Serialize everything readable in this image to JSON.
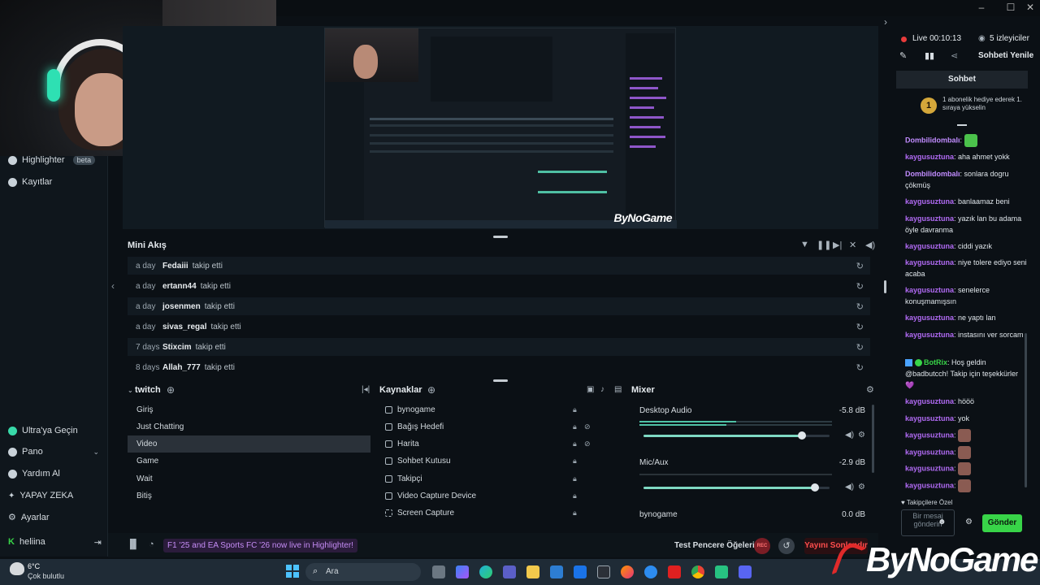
{
  "sidebar": {
    "highlighter": "Highlighter",
    "beta": "beta",
    "recordings": "Kayıtlar",
    "ultra": "Ultra'ya Geçin",
    "dashboard": "Pano",
    "help": "Yardım Al",
    "ai": "YAPAY ZEKA",
    "settings": "Ayarlar",
    "user": "heliina"
  },
  "mini_feed": {
    "title": "Mini Akış",
    "rows": [
      {
        "time": "a day",
        "user": "Fedaiii",
        "action": "takip etti"
      },
      {
        "time": "a day",
        "user": "ertann44",
        "action": "takip etti"
      },
      {
        "time": "a day",
        "user": "josenmen",
        "action": "takip etti"
      },
      {
        "time": "a day",
        "user": "sivas_regal",
        "action": "takip etti"
      },
      {
        "time": "7 days",
        "user": "Stixcim",
        "action": "takip etti"
      },
      {
        "time": "8 days",
        "user": "Allah_777",
        "action": "takip etti"
      }
    ]
  },
  "scenes": {
    "title": "twitch",
    "items": [
      "Giriş",
      "Just Chatting",
      "Video",
      "Game",
      "Wait",
      "Bitiş"
    ],
    "active_index": 2
  },
  "sources": {
    "title": "Kaynaklar",
    "items": [
      "bynogame",
      "Bağış Hedefi",
      "Harita",
      "Sohbet Kutusu",
      "Takipçi",
      "Video Capture Device",
      "Screen Capture"
    ]
  },
  "mixer": {
    "title": "Mixer",
    "channels": [
      {
        "name": "Desktop Audio",
        "db": "-5.8 dB",
        "level": 0.85
      },
      {
        "name": "Mic/Aux",
        "db": "-2.9 dB",
        "level": 0.92
      },
      {
        "name": "bynogame",
        "db": "0.0 dB",
        "level": 0
      }
    ]
  },
  "status": {
    "banner": "F1 '25 and EA Sports FC '26 now live in Highlighter!",
    "test_elements": "Test Pencere Öğeleri",
    "rec": "REC",
    "live_button": "Yayını Sonlandır"
  },
  "chat": {
    "live": "Live 00:10:13",
    "viewers": "5 izleyiciler",
    "refresh": "Sohbeti Yenile",
    "header": "Sohbet",
    "gift_badge": "1",
    "gift_text": "1 abonelik hediye ederek 1. sıraya yükselin",
    "messages": [
      {
        "user": "Dombilidombalı",
        "text": ""
      },
      {
        "user": "kaygusuztuna",
        "text": "aha ahmet yokk"
      },
      {
        "user": "Dombilidombalı",
        "text": "sonlara dogru çökmüş"
      },
      {
        "user": "kaygusuztuna",
        "text": "banlaamaz beni"
      },
      {
        "user": "kaygusuztuna",
        "text": "yazık lan bu adama öyle davranma"
      },
      {
        "user": "kaygusuztuna",
        "text": "ciddi yazık"
      },
      {
        "user": "kaygusuztuna",
        "text": "niye tolere ediyo seni acaba"
      },
      {
        "user": "kaygusuztuna",
        "text": "senelerce konuşmamışsın"
      },
      {
        "user": "kaygusuztuna",
        "text": "ne yaptı lan"
      },
      {
        "user": "kaygusuztuna",
        "text": "instasını ver sorcam"
      },
      {
        "user": "BotRix",
        "text": "Hoş geldin @badbutcch! Takip için teşekkürler 💜"
      },
      {
        "user": "kaygusuztuna",
        "text": "hööö"
      },
      {
        "user": "kaygusuztuna",
        "text": "yok"
      },
      {
        "user": "kaygusuztuna",
        "text": ""
      },
      {
        "user": "kaygusuztuna",
        "text": ""
      },
      {
        "user": "kaygusuztuna",
        "text": ""
      },
      {
        "user": "kaygusuztuna",
        "text": ""
      }
    ],
    "followers_only": "Takipçilere Özel",
    "input_placeholder": "Bir mesaj gönderin",
    "send": "Gönder"
  },
  "taskbar": {
    "weather_temp": "6°C",
    "weather_desc": "Çok bulutlu",
    "search": "Ara"
  },
  "watermark": "ByNoGame",
  "preview_watermark": "ByNoGame"
}
